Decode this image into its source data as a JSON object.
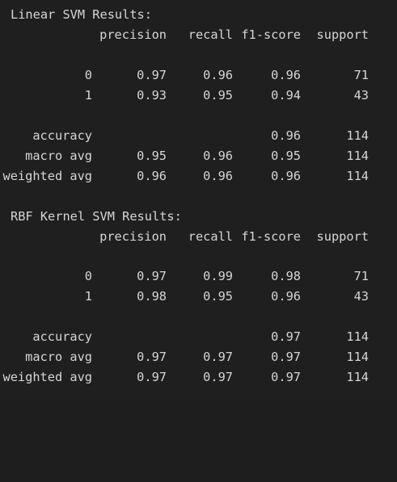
{
  "sections": [
    {
      "title": "Linear SVM Results:",
      "headers": [
        "precision",
        "recall",
        "f1-score",
        "support"
      ],
      "class_rows": [
        {
          "label": "0",
          "precision": "0.97",
          "recall": "0.96",
          "f1": "0.96",
          "support": "71"
        },
        {
          "label": "1",
          "precision": "0.93",
          "recall": "0.95",
          "f1": "0.94",
          "support": "43"
        }
      ],
      "accuracy": {
        "label": "accuracy",
        "precision": "",
        "recall": "",
        "f1": "0.96",
        "support": "114"
      },
      "summary_rows": [
        {
          "label": "macro avg",
          "precision": "0.95",
          "recall": "0.96",
          "f1": "0.95",
          "support": "114"
        },
        {
          "label": "weighted avg",
          "precision": "0.96",
          "recall": "0.96",
          "f1": "0.96",
          "support": "114"
        }
      ]
    },
    {
      "title": "RBF Kernel SVM Results:",
      "headers": [
        "precision",
        "recall",
        "f1-score",
        "support"
      ],
      "class_rows": [
        {
          "label": "0",
          "precision": "0.97",
          "recall": "0.99",
          "f1": "0.98",
          "support": "71"
        },
        {
          "label": "1",
          "precision": "0.98",
          "recall": "0.95",
          "f1": "0.96",
          "support": "43"
        }
      ],
      "accuracy": {
        "label": "accuracy",
        "precision": "",
        "recall": "",
        "f1": "0.97",
        "support": "114"
      },
      "summary_rows": [
        {
          "label": "macro avg",
          "precision": "0.97",
          "recall": "0.97",
          "f1": "0.97",
          "support": "114"
        },
        {
          "label": "weighted avg",
          "precision": "0.97",
          "recall": "0.97",
          "f1": "0.97",
          "support": "114"
        }
      ]
    }
  ]
}
